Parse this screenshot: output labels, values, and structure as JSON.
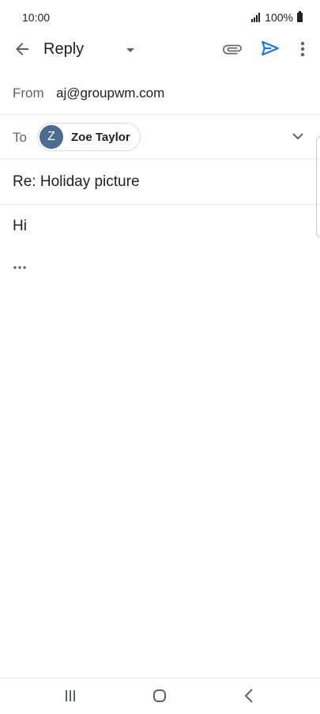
{
  "status_bar": {
    "time": "10:00",
    "battery": "100%"
  },
  "app_bar": {
    "title": "Reply",
    "icons": [
      "back-arrow-icon",
      "chevron-down-icon",
      "paperclip-icon",
      "send-icon",
      "more-vertical-icon"
    ],
    "accent_color": "#1a73e8"
  },
  "compose": {
    "from_label": "From",
    "from_value": "aj@groupwm.com",
    "to_label": "To",
    "recipient": {
      "initial": "Z",
      "name": "Zoe Taylor",
      "avatar_color": "#4b6b8f"
    },
    "subject": "Re: Holiday picture",
    "body": "Hi"
  },
  "nav_bar": {
    "icons": [
      "recents-icon",
      "home-icon",
      "back-icon"
    ]
  }
}
